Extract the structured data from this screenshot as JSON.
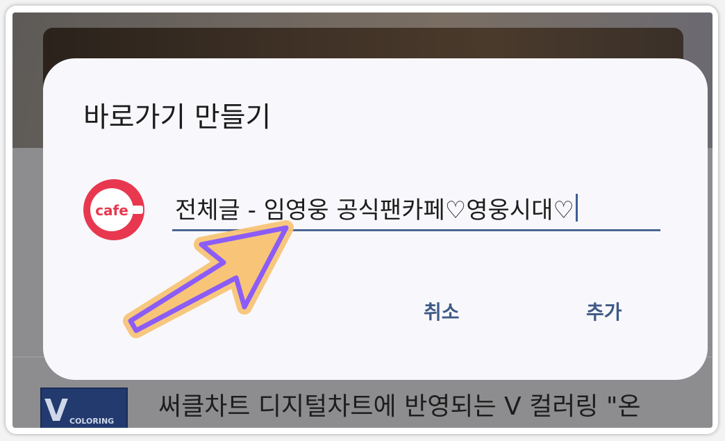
{
  "background": {
    "article_title": "써클차트 디지털차트에 반영되는 V 컬러링 \"온",
    "thumbnail_letter": "V",
    "thumbnail_caption": "COLORING"
  },
  "dialog": {
    "title": "바로가기 만들기",
    "app_icon": {
      "icon_name": "cafe-app-icon",
      "label": "cafe",
      "color": "#e8384f"
    },
    "name_input_value": "전체글 - 임영웅 공식팬카페♡영웅시대♡",
    "cancel_label": "취소",
    "add_label": "추가",
    "accent_color": "#3e5a86"
  },
  "annotation": {
    "arrow_color": "#8b5cf6",
    "arrow_glow": "#f8c477"
  }
}
